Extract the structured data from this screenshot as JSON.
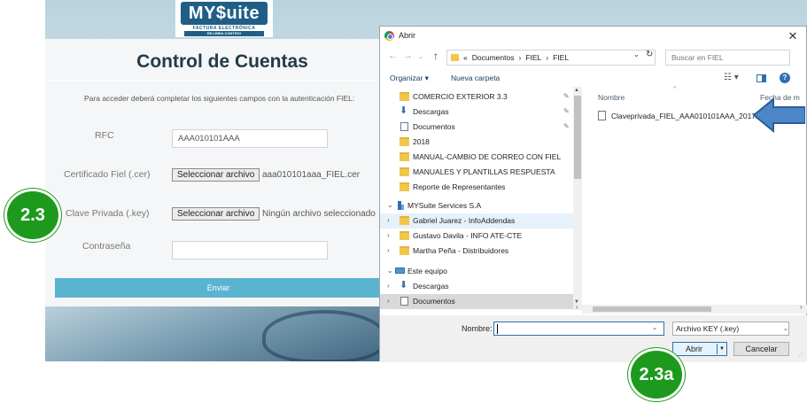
{
  "callouts": {
    "left": "2.3",
    "bottom": "2.3a"
  },
  "webpage": {
    "logo": {
      "brand": "MY$uite",
      "tagline": "FACTURA ELECTRÓNICA",
      "subtitle": "EN LÍNEA CONTIGO"
    },
    "title": "Control de Cuentas",
    "instructions": "Para acceder deberá completar los siguientes campos con la autenticación FIEL:",
    "fields": {
      "rfc_label": "RFC",
      "rfc_value": "AAA010101AAA",
      "cer_label": "Certificado Fiel (.cer)",
      "cer_button": "Seleccionar archivo",
      "cer_file": "aaa010101aaa_FIEL.cer",
      "key_label": "Clave Privada (.key)",
      "key_button": "Seleccionar archivo",
      "key_file": "Ningún archivo seleccionado",
      "password_label": "Contraseña",
      "password_value": ""
    },
    "submit_label": "Enviar"
  },
  "dialog": {
    "title": "Abrir",
    "close_glyph": "✕",
    "breadcrumb": [
      "«",
      "Documentos",
      "›",
      "FIEL",
      "›",
      "FIEL"
    ],
    "search_placeholder": "Buscar en FIEL",
    "toolbar": {
      "organize": "Organizar ▾",
      "new_folder": "Nueva carpeta"
    },
    "tree": [
      {
        "label": "COMERCIO EXTERIOR 3.3",
        "icon": "folder-icon",
        "pinned": true
      },
      {
        "label": "Descargas",
        "icon": "download-icon",
        "pinned": true
      },
      {
        "label": "Documentos",
        "icon": "documents-icon",
        "pinned": true
      },
      {
        "label": "2018",
        "icon": "folder-icon",
        "pinned": false
      },
      {
        "label": "MANUAL-CAMBIO DE CORREO CON FIEL",
        "icon": "folder-icon",
        "pinned": false
      },
      {
        "label": "MANUALES Y PLANTILLAS RESPUESTA",
        "icon": "folder-icon",
        "pinned": false
      },
      {
        "label": "Reporte de Representantes",
        "icon": "folder-icon",
        "pinned": false
      },
      {
        "label": "MYSuite Services S.A",
        "icon": "building-icon",
        "expanded": true
      },
      {
        "label": "Gabriel Juarez - InfoAddendas",
        "icon": "folder-icon",
        "selected_hover": true
      },
      {
        "label": "Gustavo Davila - INFO ATE-CTE",
        "icon": "folder-icon"
      },
      {
        "label": "Martha Peña - Distribuidores",
        "icon": "folder-icon"
      },
      {
        "label": "Este equipo",
        "icon": "computer-icon",
        "expanded": true
      },
      {
        "label": "Descargas",
        "icon": "download-icon"
      },
      {
        "label": "Documentos",
        "icon": "documents-icon",
        "selected": true
      }
    ],
    "columns": {
      "name": "Nombre",
      "date": "Fecha de m"
    },
    "files": [
      {
        "name": "Claveprivada_FIEL_AAA010101AAA_2017..."
      }
    ],
    "footer": {
      "name_label": "Nombre:",
      "name_value": "",
      "filetype": "Archivo KEY (.key)",
      "open": "Abrir",
      "cancel": "Cancelar"
    }
  }
}
